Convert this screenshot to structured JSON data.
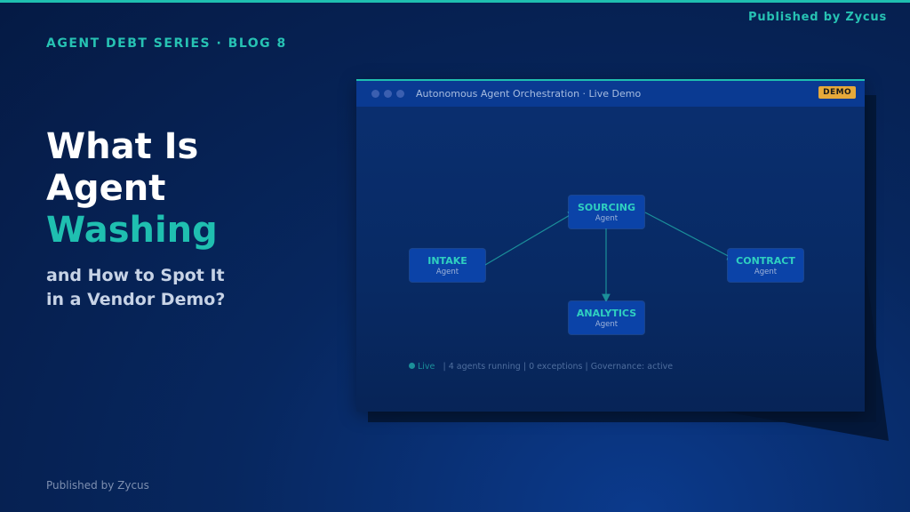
{
  "header": {
    "series": "AGENT DEBT SERIES · BLOG 8",
    "publisher": "Published by Zycus"
  },
  "headline": {
    "line1": "What Is",
    "line2": "Agent",
    "accent": "Washing",
    "sub_line1": "and How to Spot It",
    "sub_line2": "in a Vendor Demo?"
  },
  "footer": {
    "publisher": "Published by Zycus"
  },
  "demo_window": {
    "title": "Autonomous Agent Orchestration · Live Demo",
    "badge": "DEMO",
    "nodes": {
      "sourcing": {
        "name": "SOURCING",
        "sub": "Agent"
      },
      "intake": {
        "name": "INTAKE",
        "sub": "Agent"
      },
      "contract": {
        "name": "CONTRACT",
        "sub": "Agent"
      },
      "analytics": {
        "name": "ANALYTICS",
        "sub": "Agent"
      }
    },
    "status": {
      "live": "Live",
      "details": "| 4 agents running | 0 exceptions | Governance: active"
    }
  },
  "colors": {
    "accent": "#1fbfb0",
    "background": "#051a44",
    "node": "#0b43a8",
    "badge": "#e6a93a"
  }
}
